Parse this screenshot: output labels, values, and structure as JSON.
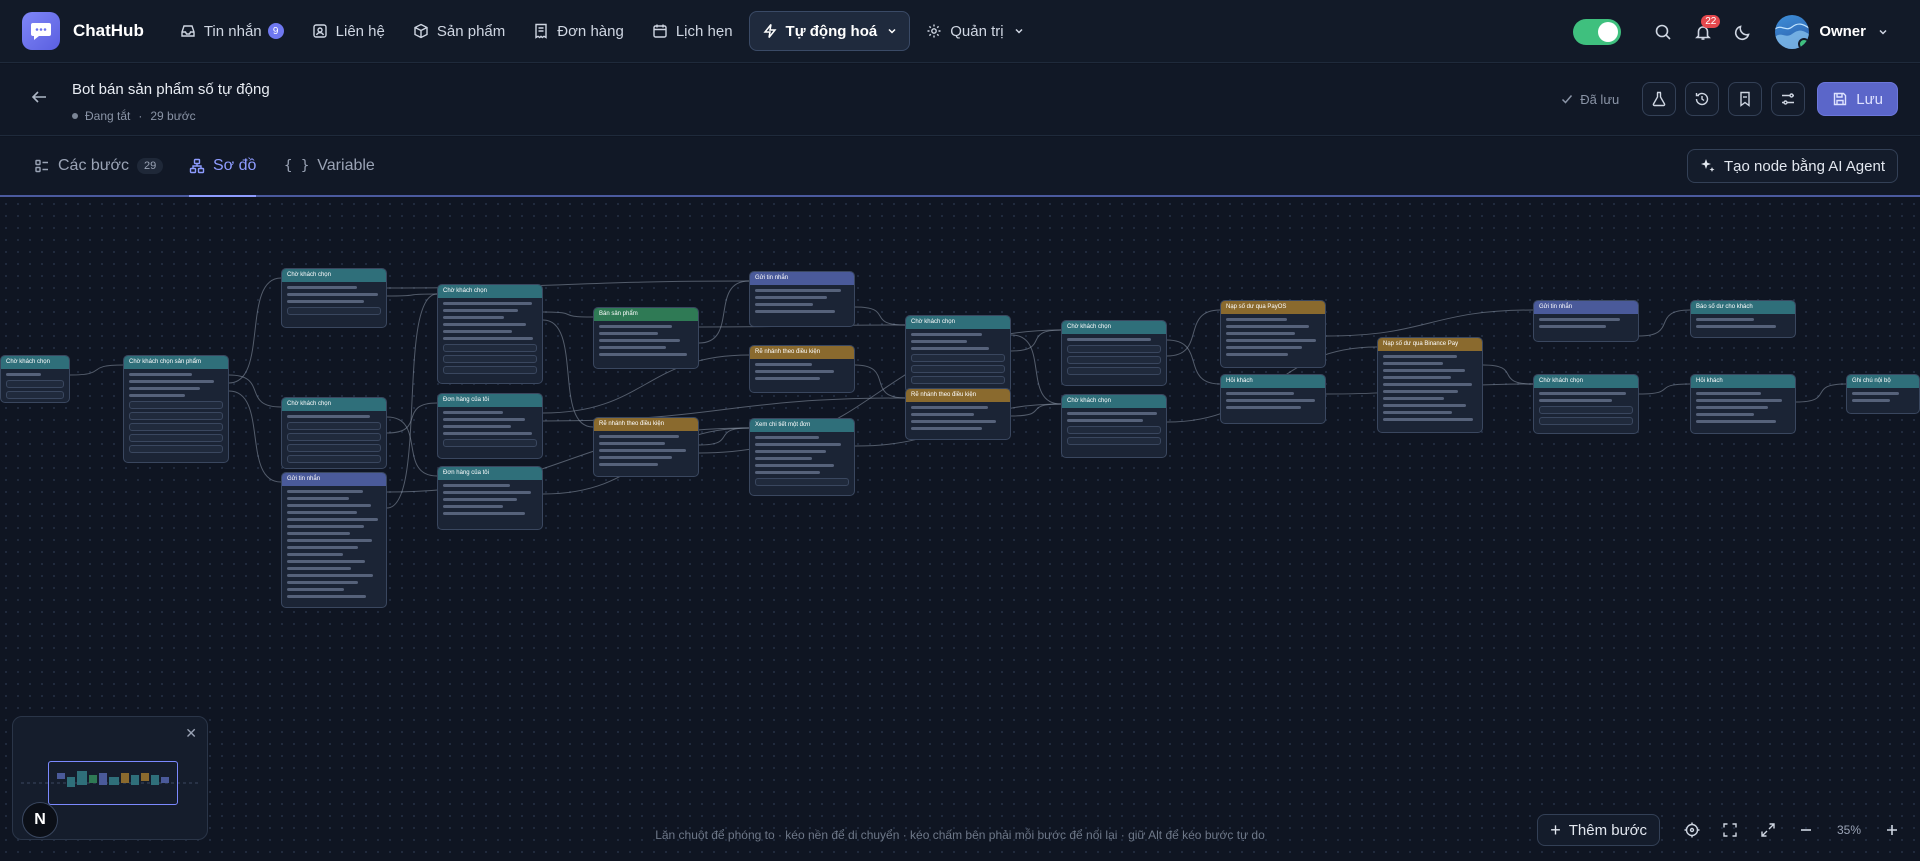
{
  "app": {
    "name": "ChatHub"
  },
  "nav": {
    "items": [
      {
        "id": "inbox",
        "label": "Tin nhắn",
        "badge": "9",
        "icon": "inbox-icon"
      },
      {
        "id": "contacts",
        "label": "Liên hệ",
        "icon": "contacts-icon"
      },
      {
        "id": "products",
        "label": "Sản phẩm",
        "icon": "box-icon"
      },
      {
        "id": "orders",
        "label": "Đơn hàng",
        "icon": "receipt-icon"
      },
      {
        "id": "calendar",
        "label": "Lịch hẹn",
        "icon": "calendar-icon"
      },
      {
        "id": "automation",
        "label": "Tự động hoá",
        "icon": "bolt-icon",
        "active": true
      },
      {
        "id": "admin",
        "label": "Quản trị",
        "icon": "gear-icon"
      }
    ],
    "notifications_count": "22",
    "user_name": "Owner",
    "status_toggle_on": true
  },
  "header": {
    "title": "Bot bán sản phẩm số tự động",
    "status": "Đang tắt",
    "steps": "29 bước",
    "saved_label": "Đã lưu",
    "save_label": "Lưu"
  },
  "tabs": {
    "steps_label": "Các bước",
    "steps_count": "29",
    "diagram_label": "Sơ đồ",
    "variable_label": "Variable",
    "ai_button_label": "Tạo node bằng AI Agent"
  },
  "canvas": {
    "hint": "Lăn chuột để phóng to · kéo nền để di chuyển · kéo chấm bên phải mỗi bước để nối lại · giữ Alt để kéo bước tự do",
    "add_step_label": "Thêm bước",
    "zoom_level": "35%",
    "minimap_badge": "N",
    "minimap_close": "✕",
    "colors": {
      "teal": "#2f6f7a",
      "blue": "#4a5a9a",
      "green": "#2f7a55",
      "amber": "#8a6a2e",
      "purple": "#5a4f8f"
    },
    "nodes": [
      {
        "title": "Chờ khách chọn",
        "color": "teal"
      },
      {
        "title": "Chờ khách chọn sản phẩm",
        "color": "teal"
      },
      {
        "title": "Chờ khách chọn",
        "color": "teal"
      },
      {
        "title": "Gửi tin nhắn",
        "color": "blue"
      },
      {
        "title": "Chờ khách chọn",
        "color": "teal"
      },
      {
        "title": "Chờ khách chọn",
        "color": "teal"
      },
      {
        "title": "Đơn hàng của tôi",
        "color": "teal"
      },
      {
        "title": "Đơn hàng của tôi",
        "color": "teal"
      },
      {
        "title": "Bán sản phẩm",
        "color": "green"
      },
      {
        "title": "Rẽ nhánh theo điều kiện",
        "color": "amber"
      },
      {
        "title": "Gửi tin nhắn",
        "color": "blue"
      },
      {
        "title": "Rẽ nhánh theo điều kiện",
        "color": "amber"
      },
      {
        "title": "Xem chi tiết một đơn",
        "color": "teal"
      },
      {
        "title": "Chờ khách chọn",
        "color": "teal"
      },
      {
        "title": "Rẽ nhánh theo điều kiện",
        "color": "amber"
      },
      {
        "title": "Chờ khách chọn",
        "color": "teal"
      },
      {
        "title": "Chờ khách chọn",
        "color": "teal"
      },
      {
        "title": "Nạp số dư qua PayOS",
        "color": "amber"
      },
      {
        "title": "Hỏi khách",
        "color": "teal"
      },
      {
        "title": "Nạp số dư qua Binance Pay",
        "color": "amber"
      },
      {
        "title": "Gửi tin nhắn",
        "color": "blue"
      },
      {
        "title": "Chờ khách chọn",
        "color": "teal"
      },
      {
        "title": "Báo số dư cho khách",
        "color": "teal"
      },
      {
        "title": "Hỏi khách",
        "color": "teal"
      },
      {
        "title": "Ghi chú nội bộ",
        "color": "teal"
      }
    ]
  }
}
